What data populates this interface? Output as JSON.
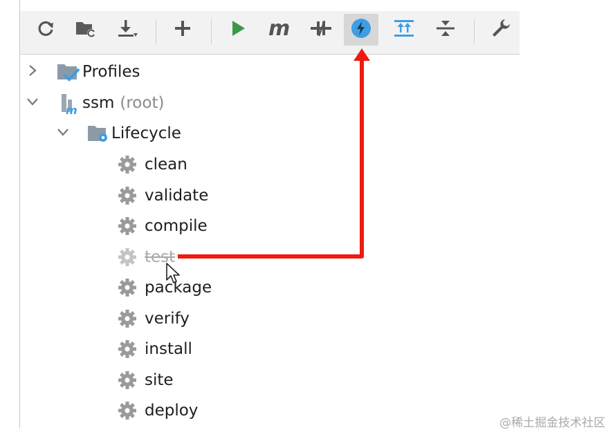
{
  "toolbar": {
    "buttons": [
      {
        "icon": "reload-icon"
      },
      {
        "icon": "generate-sources-icon"
      },
      {
        "icon": "download-icon"
      },
      {
        "icon": "add-icon"
      },
      {
        "icon": "run-icon"
      },
      {
        "icon": "maven-goal-icon"
      },
      {
        "icon": "toggle-offline-icon"
      },
      {
        "icon": "skip-tests-icon",
        "active": true
      },
      {
        "icon": "show-dependencies-icon"
      },
      {
        "icon": "collapse-all-icon"
      },
      {
        "icon": "settings-wrench-icon"
      }
    ]
  },
  "tree": {
    "profiles": {
      "label": "Profiles"
    },
    "project": {
      "label": "ssm",
      "suffix": "(root)"
    },
    "lifecycle": {
      "label": "Lifecycle",
      "phases": [
        {
          "label": "clean"
        },
        {
          "label": "validate"
        },
        {
          "label": "compile"
        },
        {
          "label": "test",
          "skipped": true
        },
        {
          "label": "package"
        },
        {
          "label": "verify"
        },
        {
          "label": "install"
        },
        {
          "label": "site"
        },
        {
          "label": "deploy"
        }
      ]
    }
  },
  "colors": {
    "accent_blue": "#3d9ee3",
    "run_green": "#3a9a4a",
    "annotation_red": "#f01a10"
  },
  "watermark": "@稀土掘金技术社区"
}
